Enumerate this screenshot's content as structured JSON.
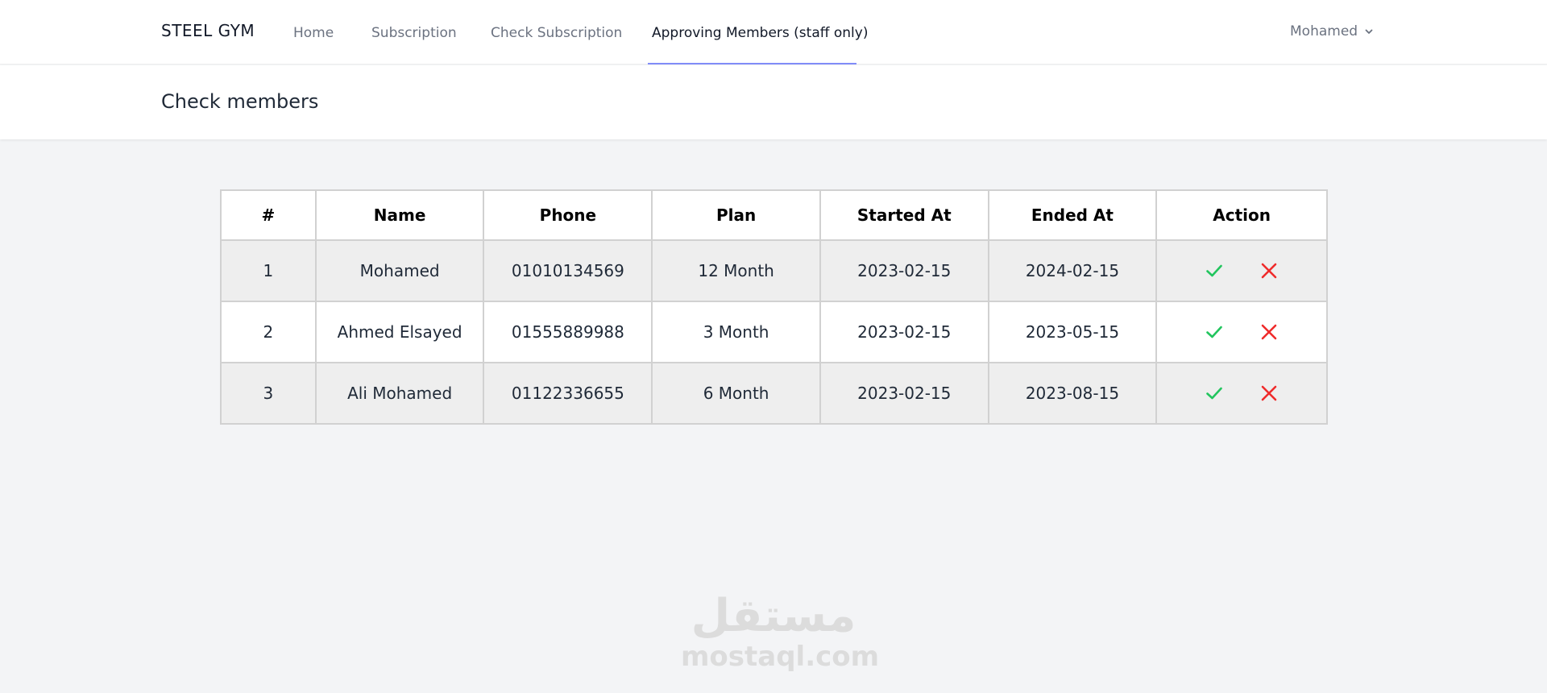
{
  "nav": {
    "brand": "STEEL GYM",
    "links": [
      {
        "label": "Home"
      },
      {
        "label": "Subscription"
      },
      {
        "label": "Check Subscription"
      },
      {
        "label": "Approving Members (staff only)"
      }
    ],
    "active_link": "Approving Members (staff only)",
    "user_name": "Mohamed"
  },
  "header": {
    "title": "Check members"
  },
  "table": {
    "columns": [
      "#",
      "Name",
      "Phone",
      "Plan",
      "Started At",
      "Ended At",
      "Action"
    ],
    "rows": [
      {
        "num": "1",
        "name": "Mohamed",
        "phone": "01010134569",
        "plan": "12 Month",
        "started": "2023-02-15",
        "ended": "2024-02-15"
      },
      {
        "num": "2",
        "name": "Ahmed Elsayed",
        "phone": "01555889988",
        "plan": "3 Month",
        "started": "2023-02-15",
        "ended": "2023-05-15"
      },
      {
        "num": "3",
        "name": "Ali Mohamed",
        "phone": "01122336655",
        "plan": "6 Month",
        "started": "2023-02-15",
        "ended": "2023-08-15"
      }
    ]
  },
  "icons": {
    "approve": "check-icon",
    "reject": "close-icon",
    "user_menu": "chevron-down-icon"
  },
  "colors": {
    "approve": "#22c55e",
    "reject": "#ef2b2b",
    "active_underline": "#818cf8"
  },
  "watermark": {
    "logo_text": "مستقل",
    "site": "mostaql.com"
  }
}
